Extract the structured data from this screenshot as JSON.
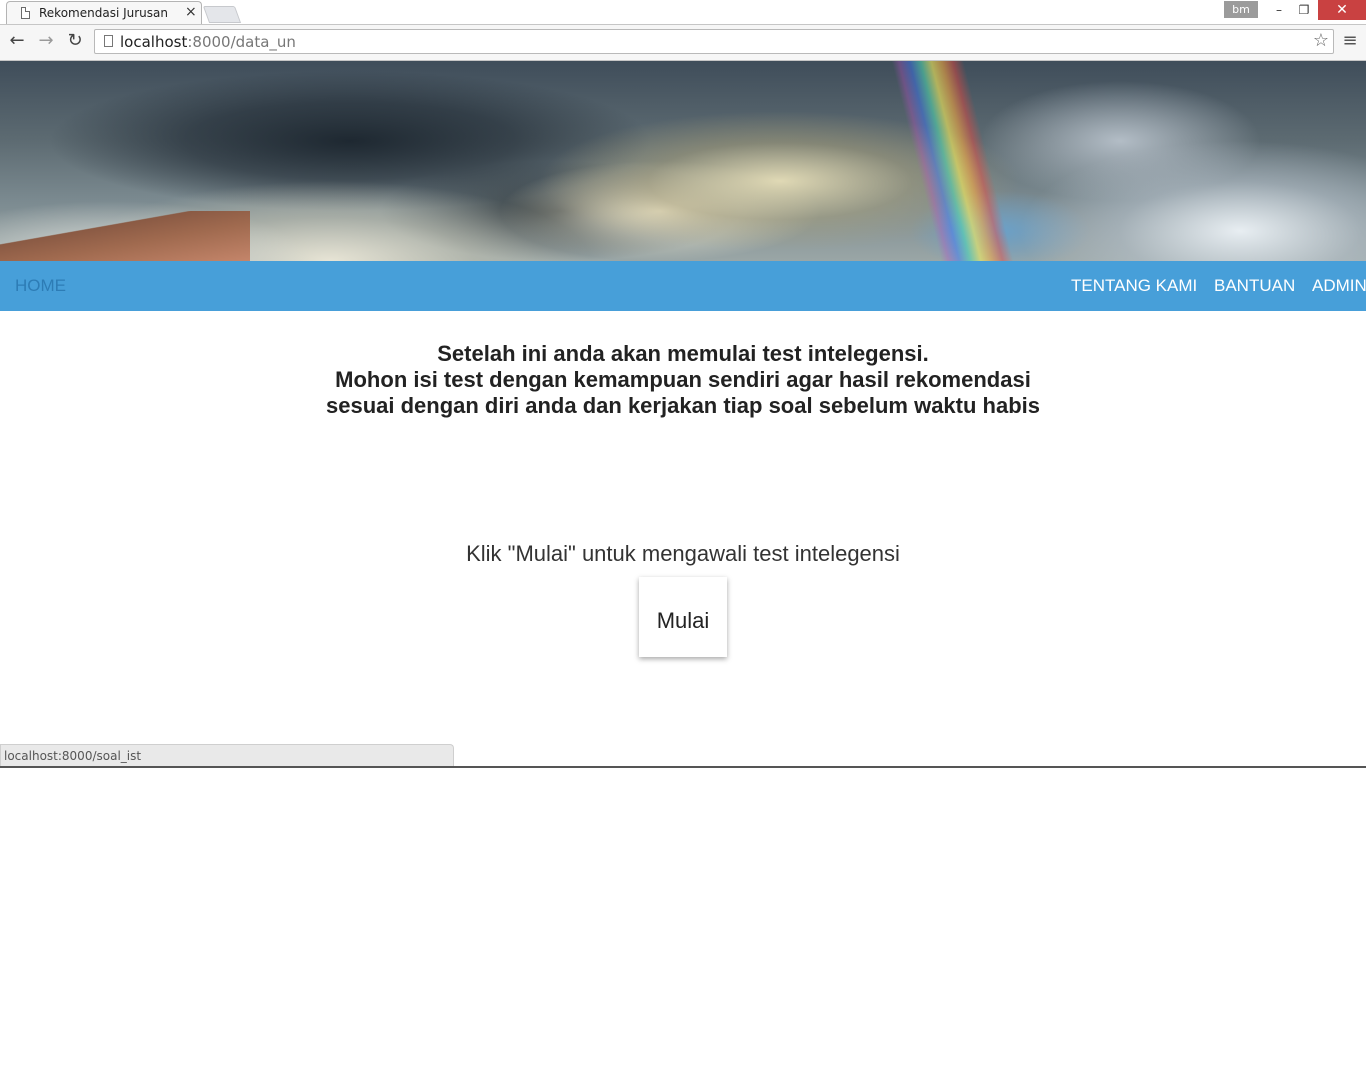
{
  "browser": {
    "tab_title": "Rekomendasi Jurusan",
    "tab_close": "×",
    "profile": "bm",
    "window_controls": {
      "minimize": "–",
      "restore": "❐",
      "close": "✕"
    },
    "url_host": "localhost",
    "url_rest": ":8000/data_un",
    "status_url": "localhost:8000/soal_ist",
    "icons": {
      "back": "←",
      "forward": "→",
      "reload": "↻",
      "star": "☆",
      "menu": "≡"
    }
  },
  "navbar": {
    "home": "HOME",
    "about": "TENTANG KAMI",
    "help": "BANTUAN",
    "admin": "ADMIN",
    "bg_color": "#479fd9"
  },
  "main": {
    "heading_line1": "Setelah ini anda akan memulai test intelegensi.",
    "heading_line2": "Mohon isi test dengan kemampuan sendiri agar hasil rekomendasi",
    "heading_line3": "sesuai dengan diri anda dan kerjakan tiap soal sebelum waktu habis",
    "instruction": "Klik \"Mulai\" untuk mengawali test intelegensi",
    "start_button": "Mulai"
  }
}
